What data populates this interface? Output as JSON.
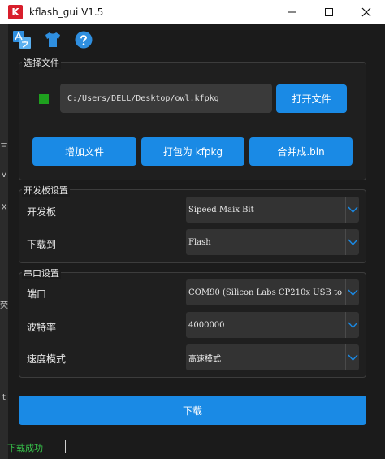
{
  "window": {
    "logo_letter": "K",
    "title": "kflash_gui V1.5"
  },
  "toolbar": {
    "icons": [
      "translate-icon",
      "tshirt-icon",
      "help-icon"
    ]
  },
  "edge": {
    "chars": [
      "三",
      "v",
      "X",
      "荧",
      "t"
    ]
  },
  "file_group": {
    "title": "选择文件",
    "path_value": "C:/Users/DELL/Desktop/owl.kfpkg",
    "open_button": "打开文件",
    "add_button": "增加文件",
    "pack_button": "打包为 kfpkg",
    "merge_button": "合并成.bin"
  },
  "board_group": {
    "title": "开发板设置",
    "board_label": "开发板",
    "board_value": "Sipeed Maix Bit",
    "target_label": "下载到",
    "target_value": "Flash"
  },
  "serial_group": {
    "title": "串口设置",
    "port_label": "端口",
    "port_value": "COM90 (Silicon Labs CP210x USB to",
    "baud_label": "波特率",
    "baud_value": "4000000",
    "speed_label": "速度模式",
    "speed_value": "高速模式"
  },
  "download_button": "下载",
  "status": {
    "text": "下载成功"
  },
  "colors": {
    "accent": "#1a8ae5",
    "status_ok": "#37c34a",
    "indicator": "#1ea01e",
    "logo": "#d81e2b"
  }
}
